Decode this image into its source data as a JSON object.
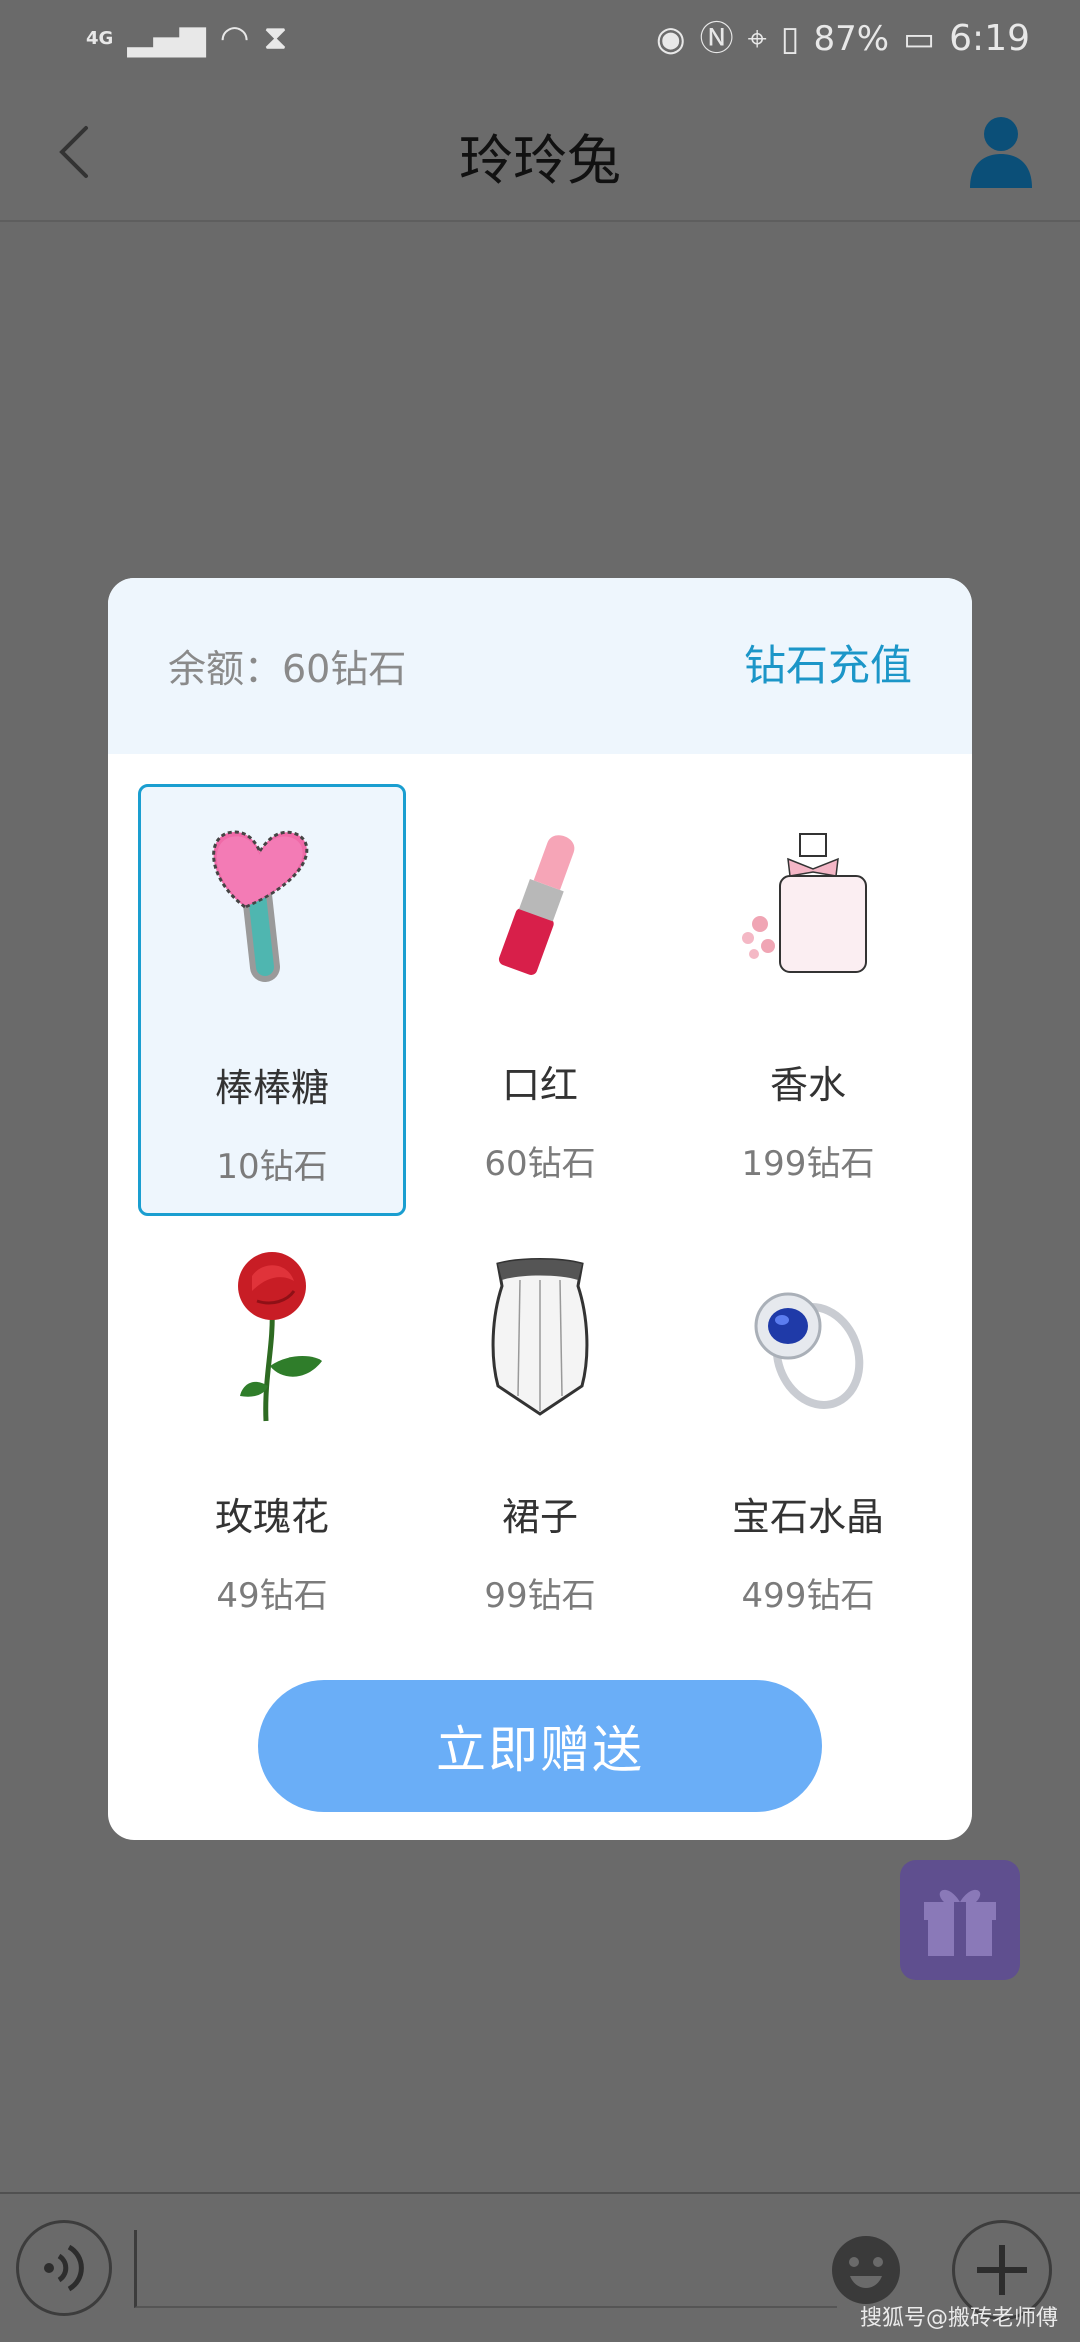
{
  "status_bar": {
    "network": "4G",
    "battery": "87%",
    "time": "6:19"
  },
  "header": {
    "title": "玲玲兔"
  },
  "dialog": {
    "balance": "余额：60钻石",
    "recharge_label": "钻石充值",
    "gifts": [
      {
        "name": "棒棒糖",
        "price": "10钻石",
        "icon": "lollipop-icon",
        "selected": true
      },
      {
        "name": "口红",
        "price": "60钻石",
        "icon": "lipstick-icon",
        "selected": false
      },
      {
        "name": "香水",
        "price": "199钻石",
        "icon": "perfume-icon",
        "selected": false
      },
      {
        "name": "玫瑰花",
        "price": "49钻石",
        "icon": "rose-icon",
        "selected": false
      },
      {
        "name": "裙子",
        "price": "99钻石",
        "icon": "dress-icon",
        "selected": false
      },
      {
        "name": "宝石水晶",
        "price": "499钻石",
        "icon": "gem-ring-icon",
        "selected": false
      }
    ],
    "send_label": "立即赠送"
  },
  "watermark": "搜狐号@搬砖老师傅",
  "colors": {
    "accent": "#1c96c8",
    "send_button": "#6aaef7",
    "overlay": "#6a6a6a",
    "dialog_header": "#eef6fd"
  }
}
